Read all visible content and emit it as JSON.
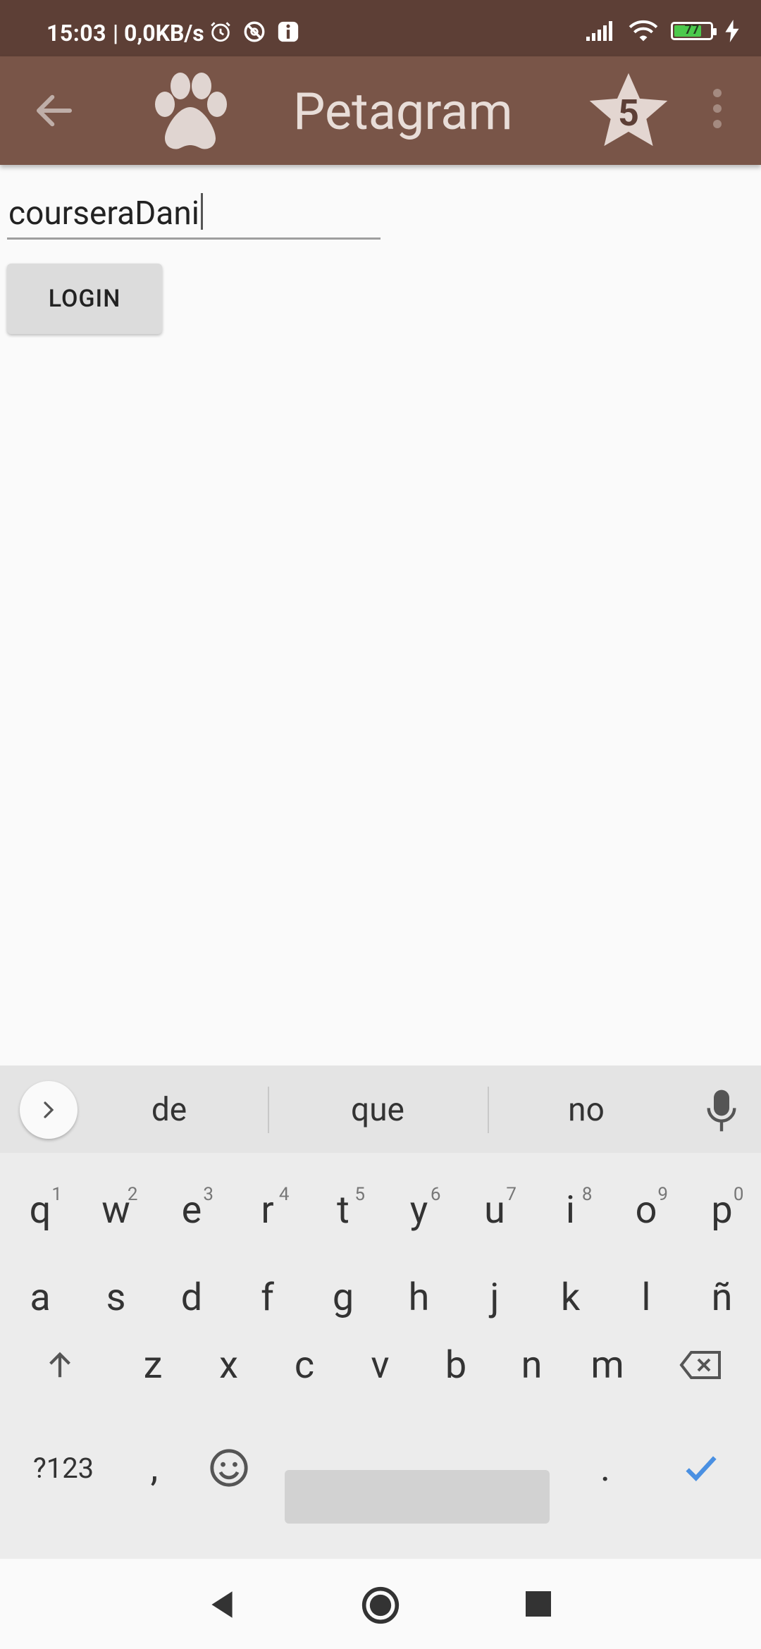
{
  "status_bar": {
    "time": "15:03",
    "network_speed": "| 0,0KB/s",
    "battery_level": "77",
    "icons": [
      "alarm-icon",
      "do-not-disturb-icon",
      "info-icon",
      "signal-icon",
      "wifi-icon",
      "battery-icon",
      "charging-icon"
    ]
  },
  "app_bar": {
    "title": "Petagram",
    "star_count": "5",
    "icons": [
      "back-arrow-icon",
      "paw-icon",
      "star-icon",
      "overflow-menu-icon"
    ]
  },
  "form": {
    "username_value": "courseraDani",
    "login_label": "LOGIN"
  },
  "keyboard": {
    "suggestions": [
      "de",
      "que",
      "no"
    ],
    "row1": [
      {
        "key": "q",
        "sup": "1"
      },
      {
        "key": "w",
        "sup": "2"
      },
      {
        "key": "e",
        "sup": "3"
      },
      {
        "key": "r",
        "sup": "4"
      },
      {
        "key": "t",
        "sup": "5"
      },
      {
        "key": "y",
        "sup": "6"
      },
      {
        "key": "u",
        "sup": "7"
      },
      {
        "key": "i",
        "sup": "8"
      },
      {
        "key": "o",
        "sup": "9"
      },
      {
        "key": "p",
        "sup": "0"
      }
    ],
    "row2": [
      "a",
      "s",
      "d",
      "f",
      "g",
      "h",
      "j",
      "k",
      "l",
      "ñ"
    ],
    "row3": [
      "z",
      "x",
      "c",
      "v",
      "b",
      "n",
      "m"
    ],
    "symbols_label": "?123",
    "comma": ",",
    "period": ".",
    "accent_color": "#4a90e2"
  },
  "colors": {
    "status_bar": "#5d3f36",
    "app_bar": "#795548",
    "title_text": "#e8ddd8"
  }
}
